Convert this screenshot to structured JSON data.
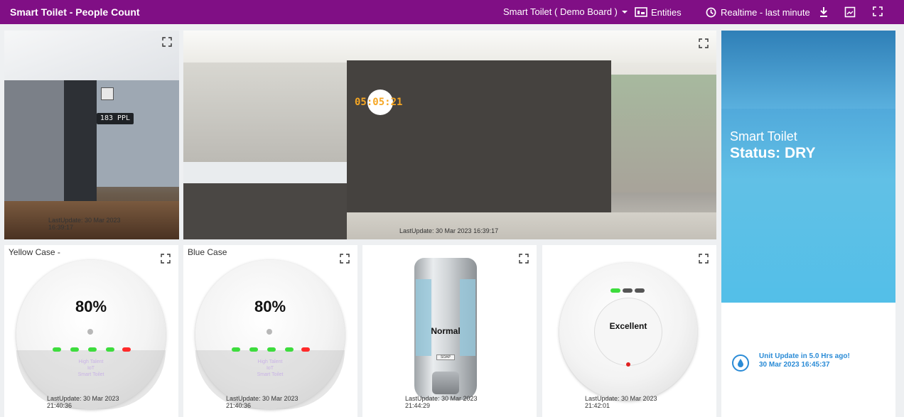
{
  "header": {
    "title": "Smart Toilet - People Count",
    "board": "Smart Toilet ( Demo Board )",
    "entities": "Entities",
    "time": "Realtime - last minute"
  },
  "widgets": {
    "entrance": {
      "counter": "183 PPL",
      "lastupdate_1": "LastUpdate: 30 Mar 2023",
      "lastupdate_2": "16:39:17"
    },
    "restroom": {
      "clock": "05:05:21",
      "lastupdate": "LastUpdate: 30 Mar 2023 16:39:17"
    },
    "status": {
      "line1": "Smart Toilet",
      "line2": "Status: DRY",
      "update_1": "Unit Update in 5.0 Hrs ago!",
      "update_2": "30 Mar 2023 16:45:37"
    },
    "yellow": {
      "label": "Yellow Case -",
      "percent": "80%",
      "text1": "High Talent",
      "text2": "IoT",
      "text3": "Smart Toilet",
      "lastupdate_1": "LastUpdate: 30 Mar 2023",
      "lastupdate_2": "21:40:36"
    },
    "blue": {
      "label": "Blue Case",
      "percent": "80%",
      "text1": "High Talent",
      "text2": "IoT",
      "text3": "Smart Toilet",
      "lastupdate_1": "LastUpdate: 30 Mar 2023",
      "lastupdate_2": "21:40:36"
    },
    "soap": {
      "status": "Normal",
      "brand": "SOAP",
      "lastupdate_1": "LastUpdate: 30 Mar 2023",
      "lastupdate_2": "21:44:29"
    },
    "air": {
      "status": "Excellent",
      "lastupdate_1": "LastUpdate: 30 Mar 2023",
      "lastupdate_2": "21:42:01"
    }
  },
  "colors": {
    "header": "#800f85",
    "clock": "#f5a623",
    "status_text": "#2a8bd6",
    "led_green": "#3ddc3d",
    "led_red": "#ff2a2a"
  }
}
